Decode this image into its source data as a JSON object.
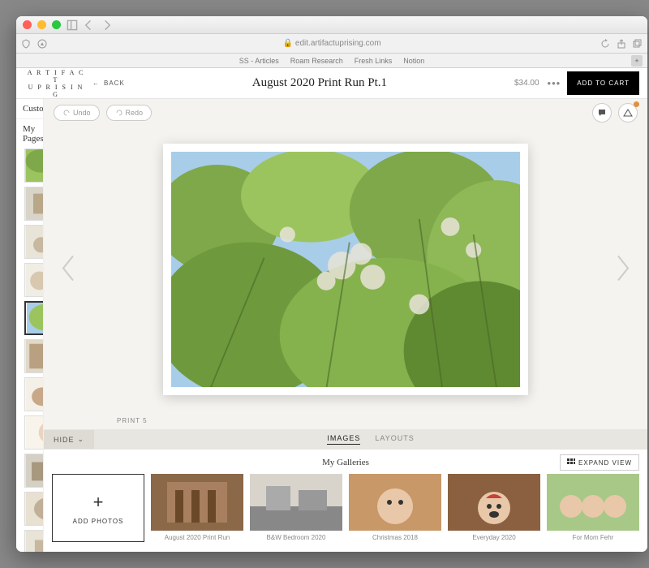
{
  "browser": {
    "domain": "edit.artifactuprising.com",
    "favorites": [
      "SS - Articles",
      "Roam Research",
      "Fresh Links",
      "Notion"
    ]
  },
  "header": {
    "brand_line1": "A R T I F A C T",
    "brand_line2": "U P R I S I N G",
    "back_label": "BACK",
    "title": "August 2020 Print Run Pt.1",
    "price": "$34.00",
    "add_to_cart": "ADD TO CART"
  },
  "sidebar": {
    "customize_label": "Customize",
    "mypages_label": "My Pages",
    "thumb_count": 11,
    "selected_index": 4
  },
  "toolbar": {
    "undo": "Undo",
    "redo": "Redo"
  },
  "canvas": {
    "page_label": "PRINT 5"
  },
  "bottom": {
    "hide_label": "HIDE",
    "tab_images": "IMAGES",
    "tab_layouts": "LAYOUTS",
    "my_galleries": "My Galleries",
    "expand_view": "EXPAND VIEW",
    "add_photos": "ADD PHOTOS",
    "galleries": [
      "August 2020 Print Run",
      "B&W Bedroom 2020",
      "Christmas 2018",
      "Everyday 2020",
      "For Mom Fehr"
    ]
  }
}
